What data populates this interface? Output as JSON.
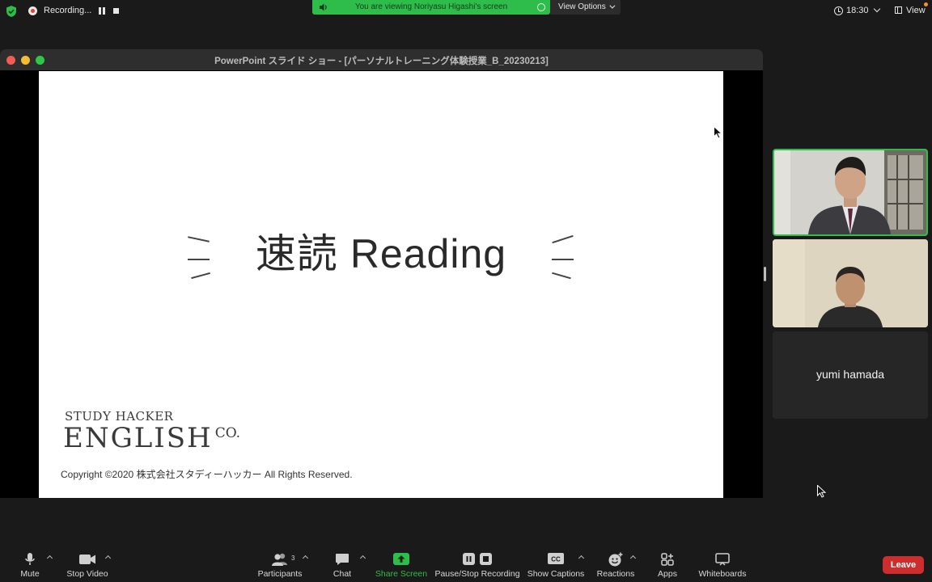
{
  "topbar": {
    "recording_label": "Recording...",
    "viewing_banner": "You are viewing Noriyasu Higashi's screen",
    "view_options_label": "View Options",
    "time": "18:30",
    "view_label": "View"
  },
  "share": {
    "window_title": "PowerPoint スライド ショー - [パーソナルトレーニング体験授業_B_20230213]",
    "slide": {
      "heading": "速読 Reading",
      "brand_top": "STUDY HACKER",
      "brand_main": "ENGLISH",
      "brand_suffix": "CO.",
      "copyright": "Copyright ©2020 株式会社スタディーハッカー All Rights Reserved."
    }
  },
  "participants": {
    "tiles": [
      {
        "type": "video",
        "active_speaker": true
      },
      {
        "type": "video",
        "active_speaker": false
      },
      {
        "type": "name",
        "name": "yumi hamada"
      }
    ]
  },
  "toolbar": {
    "mute_label": "Mute",
    "video_label": "Stop Video",
    "participants_label": "Participants",
    "participants_count": "3",
    "chat_label": "Chat",
    "share_label": "Share Screen",
    "recording_label": "Pause/Stop Recording",
    "captions_label": "Show Captions",
    "captions_icon_text": "CC",
    "reactions_label": "Reactions",
    "apps_label": "Apps",
    "whiteboards_label": "Whiteboards",
    "leave_label": "Leave"
  },
  "colors": {
    "accent_green": "#2ebd4b",
    "leave_red": "#cc2e2e",
    "record_red": "#e0433a"
  }
}
